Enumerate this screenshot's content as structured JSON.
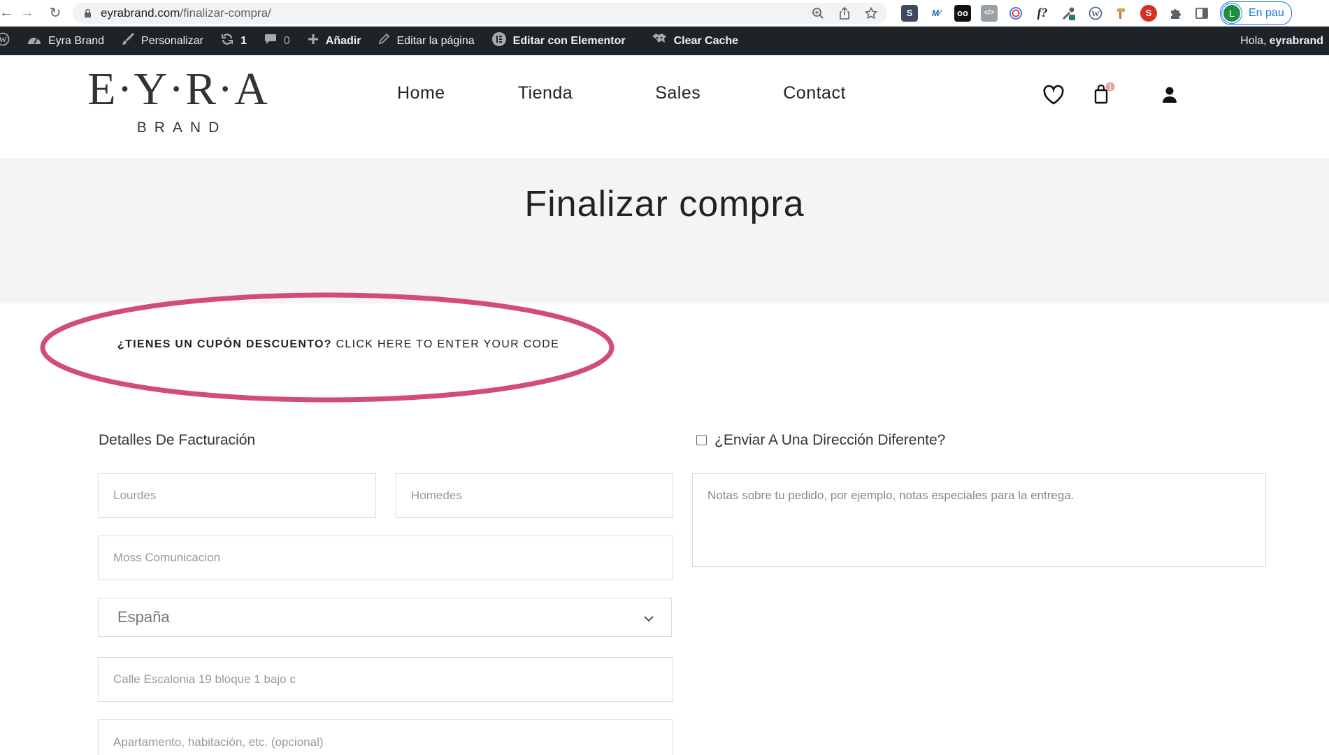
{
  "browser": {
    "url_host": "eyrabrand.com",
    "url_path": "/finalizar-compra/",
    "profile_initial": "L",
    "pause_label": "En pau",
    "extensions": [
      {
        "icon": "s-extension-icon",
        "label": "S",
        "color": "#3c4a5c"
      },
      {
        "icon": "m-extension-icon",
        "label": "M",
        "color": "#ffffff"
      },
      {
        "icon": "oo-extension-icon",
        "label": "oo",
        "color": "#111111"
      },
      {
        "icon": "code-extension-icon",
        "label": "</>",
        "color": "#9aa0a6"
      },
      {
        "icon": "spiral-extension-icon",
        "label": "",
        "color": "#ffffff"
      },
      {
        "icon": "fontface-extension-icon",
        "label": "f?",
        "color": "#ffffff"
      },
      {
        "icon": "eyedropper-extension-icon",
        "label": "",
        "color": "#ffffff"
      },
      {
        "icon": "wordpress-extension-icon",
        "label": "W",
        "color": "#ffffff"
      },
      {
        "icon": "hammer-extension-icon",
        "label": "",
        "color": "#ffffff"
      },
      {
        "icon": "red-s-extension-icon",
        "label": "S",
        "color": "#d93025"
      }
    ]
  },
  "adminbar": {
    "site": "Eyra Brand",
    "customize": "Personalizar",
    "updates": "1",
    "comments": "0",
    "add_new": "Añadir",
    "edit_page": "Editar la página",
    "elementor": "Editar con Elementor",
    "clear_cache": "Clear Cache",
    "greeting": "Hola,",
    "username": "eyrabrand"
  },
  "header": {
    "logo_main": "E·Y·R·A",
    "logo_sub": "BRAND",
    "nav": [
      "Home",
      "Tienda",
      "Sales",
      "Contact"
    ],
    "cart_count": "1"
  },
  "page": {
    "title": "Finalizar compra",
    "coupon_question": "¿TIENES UN CUPÓN DESCUENTO?",
    "coupon_link": "CLICK HERE TO ENTER YOUR CODE"
  },
  "billing": {
    "heading": "Detalles De Facturación",
    "first_name": "Lourdes",
    "last_name": "Homedes",
    "company": "Moss Comunicacion",
    "country": "España",
    "address_1": "Calle Escalonia 19 bloque 1 bajo c",
    "address_2_placeholder": "Apartamento, habitación, etc. (opcional)"
  },
  "shipping": {
    "ship_different": "¿Enviar A Una Dirección Diferente?",
    "notes_placeholder": "Notas sobre tu pedido, por ejemplo, notas especiales para la entrega."
  },
  "colors": {
    "admin_bar": "#1d2327",
    "highlight_ellipse": "#d24a7e",
    "title_band": "#f4f4f4",
    "cart_badge": "#e8a3a3"
  }
}
